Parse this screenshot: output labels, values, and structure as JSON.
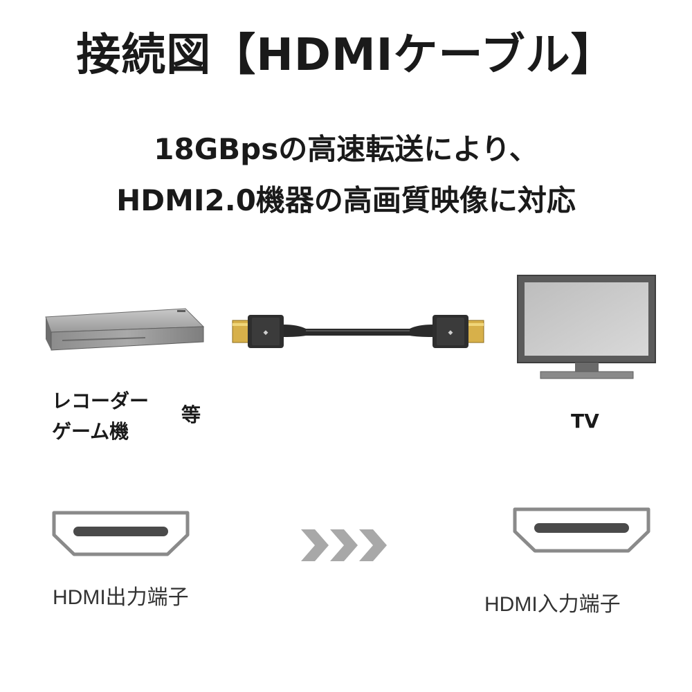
{
  "header": {
    "title": "接続図【HDMIケーブル】",
    "subtitle_line1": "18GBpsの高速転送により、",
    "subtitle_line2": "HDMI2.0機器の高画質映像に対応"
  },
  "devices": {
    "source_line1": "レコーダー",
    "source_line2": "ゲーム機",
    "source_suffix": "等",
    "target": "TV"
  },
  "ports": {
    "output_label": "HDMI出力端子",
    "input_label": "HDMI入力端子"
  },
  "colors": {
    "text": "#1a1a1a",
    "port_outline": "#8a8a8a",
    "arrow": "#a8a8a8",
    "connector_gold": "#d7b04a"
  }
}
